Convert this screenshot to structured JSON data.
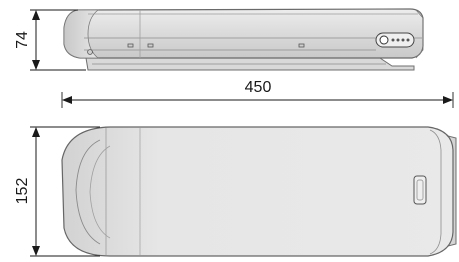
{
  "dimensions": {
    "height": "74",
    "length": "450",
    "width": "152"
  }
}
